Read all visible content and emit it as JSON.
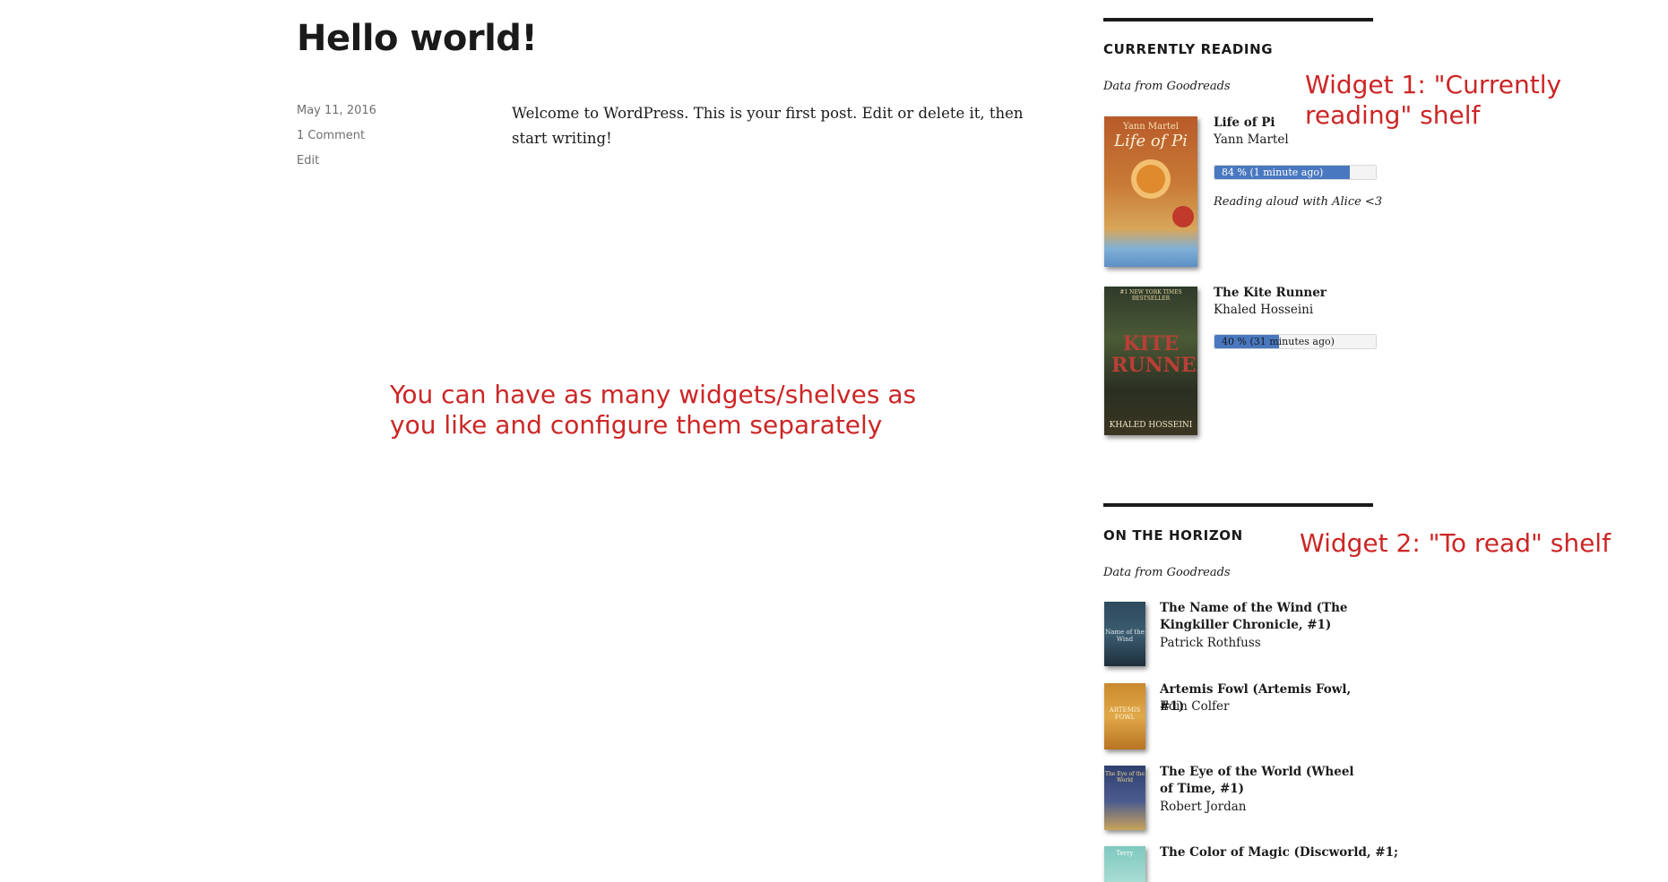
{
  "post": {
    "title": "Hello world!",
    "date": "May 11, 2016",
    "comments": "1 Comment",
    "edit": "Edit",
    "body": "Welcome to WordPress. This is your first post. Edit or delete it, then start writing!"
  },
  "annotations": {
    "widget1": "Widget 1: \"Currently reading\" shelf",
    "widget2": "Widget 2: \"To read\" shelf",
    "middle": "You can have as many widgets/shelves as you like and configure them separately"
  },
  "widget1": {
    "title": "CURRENTLY READING",
    "credit": "Data from Goodreads",
    "books": [
      {
        "title": "Life of Pi",
        "author": "Yann Martel",
        "progress": 84,
        "progress_label": "84 % (1 minute ago)",
        "comment": "Reading aloud with Alice <3",
        "cover": {
          "top": "Yann Martel",
          "main": "Life of Pi"
        }
      },
      {
        "title": "The Kite Runner",
        "author": "Khaled Hosseini",
        "progress": 40,
        "progress_label": "40 % (31 minutes ago)",
        "comment": "",
        "cover": {
          "top": "#1 NEW YORK TIMES BESTSELLER",
          "main": "KITE RUNNER",
          "bottom": "KHALED HOSSEINI"
        }
      }
    ]
  },
  "widget2": {
    "title": "ON THE HORIZON",
    "credit": "Data from Goodreads",
    "books": [
      {
        "title": "The Name of the Wind (The Kingkiller Chronicle, #1)",
        "author": "Patrick Rothfuss",
        "cover": {
          "main": "Name of the Wind"
        }
      },
      {
        "title": "Artemis Fowl (Artemis Fowl, #1)",
        "author": "Eoin Colfer",
        "cover": {
          "main": "ARTEMIS FOWL"
        }
      },
      {
        "title": "The Eye of the World (Wheel of Time, #1)",
        "author": "Robert Jordan",
        "cover": {
          "main": "The Eye of the World"
        }
      },
      {
        "title": "The Color of Magic (Discworld, #1;",
        "author": "",
        "cover": {
          "main": "Terry"
        }
      }
    ]
  },
  "colors": {
    "annotation": "#cc2626",
    "progress_fill": "#4a78c0",
    "text": "#1a1a1a",
    "meta": "#6f6f6f"
  }
}
